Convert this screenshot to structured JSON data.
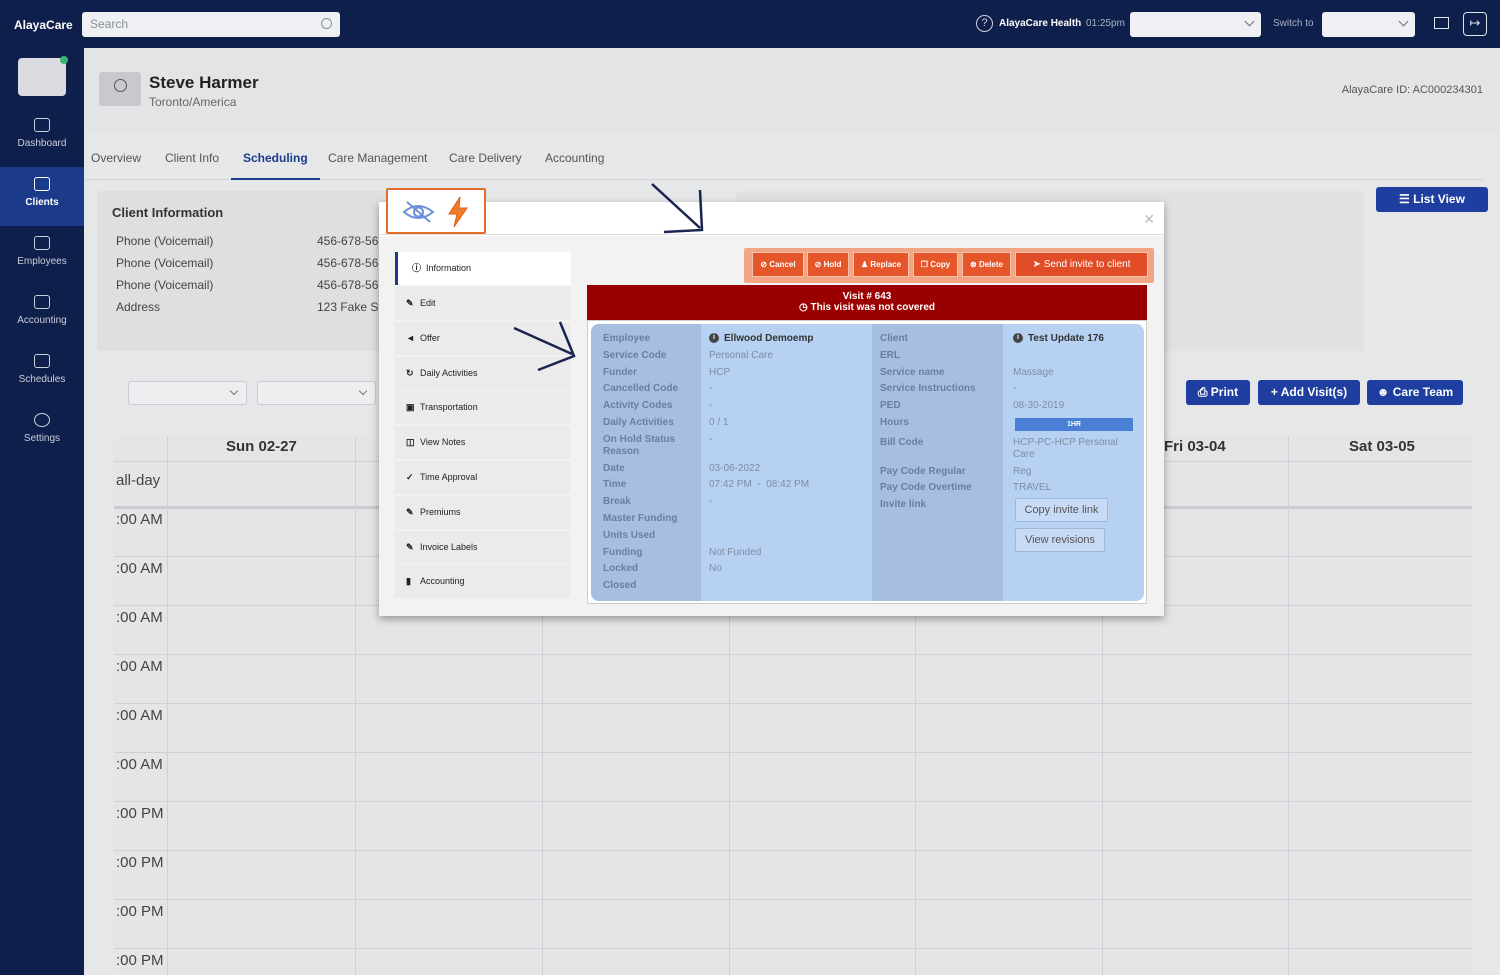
{
  "topbar": {
    "logo": "AlayaCare",
    "search_placeholder": "Search",
    "org_name": "AlayaCare Health",
    "time": "01:25pm",
    "switch_label": "Switch to"
  },
  "sidebar": {
    "items": [
      {
        "label": "Dashboard",
        "icon": "dashboard-icon"
      },
      {
        "label": "Clients",
        "icon": "clients-icon"
      },
      {
        "label": "Employees",
        "icon": "employees-icon"
      },
      {
        "label": "Accounting",
        "icon": "accounting-icon"
      },
      {
        "label": "Schedules",
        "icon": "schedules-icon"
      },
      {
        "label": "Settings",
        "icon": "settings-icon"
      }
    ],
    "active": "Clients"
  },
  "client": {
    "name": "Steve Harmer",
    "location": "Toronto/America",
    "id_text": "AlayaCare ID: AC000234301"
  },
  "tabs": [
    "Overview",
    "Client Info",
    "Scheduling",
    "Care Management",
    "Care Delivery",
    "Accounting"
  ],
  "active_tab": "Scheduling",
  "client_info": {
    "title": "Client Information",
    "rows": [
      {
        "label": "Phone (Voicemail)",
        "value": "456-678-56"
      },
      {
        "label": "Phone (Voicemail)",
        "value": "456-678-56"
      },
      {
        "label": "Phone (Voicemail)",
        "value": "456-678-56"
      },
      {
        "label": "Address",
        "value": "123 Fake St"
      }
    ]
  },
  "buttons": {
    "list_view": "List View",
    "print": "Print",
    "add_visits": "Add Visit(s)",
    "care_team": "Care Team"
  },
  "calendar": {
    "days": [
      "Sun 02-27",
      "Fri 03-04",
      "Sat 03-05"
    ],
    "allday": "all-day",
    "times": [
      ":00 AM",
      ":00 AM",
      ":00 AM",
      ":00 AM",
      ":00 AM",
      ":00 AM",
      ":00 PM",
      ":00 PM",
      ":00 PM",
      ":00 PM"
    ]
  },
  "modal": {
    "menu": [
      {
        "label": "Information",
        "icon": "info-icon"
      },
      {
        "label": "Edit",
        "icon": "pencil-icon"
      },
      {
        "label": "Offer",
        "icon": "megaphone-icon"
      },
      {
        "label": "Daily Activities",
        "icon": "history-icon"
      },
      {
        "label": "Transportation",
        "icon": "car-icon"
      },
      {
        "label": "View Notes",
        "icon": "book-icon"
      },
      {
        "label": "Time Approval",
        "icon": "check-icon"
      },
      {
        "label": "Premiums",
        "icon": "pencil-icon"
      },
      {
        "label": "Invoice Labels",
        "icon": "pencil-icon"
      },
      {
        "label": "Accounting",
        "icon": "bar-chart-icon"
      }
    ],
    "actions": [
      "Cancel",
      "Hold",
      "Replace",
      "Copy",
      "Delete",
      "Send invite to client"
    ],
    "visit_title": "Visit # 643",
    "visit_status": "This visit was not covered",
    "left_fields": [
      {
        "label": "Employee",
        "value": "Ellwood Demoemp"
      },
      {
        "label": "Service Code",
        "value": "Personal Care"
      },
      {
        "label": "Funder",
        "value": "HCP"
      },
      {
        "label": "Cancelled Code",
        "value": "-"
      },
      {
        "label": "Activity Codes",
        "value": "-"
      },
      {
        "label": "Daily Activities",
        "value": "0 / 1"
      },
      {
        "label": "On Hold Status Reason",
        "value": "-"
      },
      {
        "label": "Date",
        "value": "03-06-2022"
      },
      {
        "label": "Time",
        "value": "07:42 PM  -  08:42 PM"
      },
      {
        "label": "Break",
        "value": "-"
      },
      {
        "label": "Master Funding",
        "value": ""
      },
      {
        "label": "Units Used",
        "value": ""
      },
      {
        "label": "Funding",
        "value": "Not Funded"
      },
      {
        "label": "Locked",
        "value": "No"
      },
      {
        "label": "Closed",
        "value": ""
      }
    ],
    "right_fields": [
      {
        "label": "Client",
        "value": "Test Update 176"
      },
      {
        "label": "ERL",
        "value": ""
      },
      {
        "label": "Service name",
        "value": "Massage"
      },
      {
        "label": "Service Instructions",
        "value": "-"
      },
      {
        "label": "PED",
        "value": "08-30-2019"
      },
      {
        "label": "Hours",
        "value": "1HR"
      },
      {
        "label": "Bill Code",
        "value": "HCP-PC-HCP Personal Care"
      },
      {
        "label": "Pay Code Regular",
        "value": "Reg"
      },
      {
        "label": "Pay Code Overtime",
        "value": "TRAVEL"
      },
      {
        "label": "Invite link",
        "value": ""
      }
    ],
    "copy_invite": "Copy invite link",
    "view_revisions": "View revisions"
  },
  "colors": {
    "navy": "#0f1f4b",
    "primary_blue": "#1e3fa0",
    "action_orange": "#e5562a",
    "banner_red": "#9b0000",
    "panel_blue": "#b7d1f3"
  }
}
